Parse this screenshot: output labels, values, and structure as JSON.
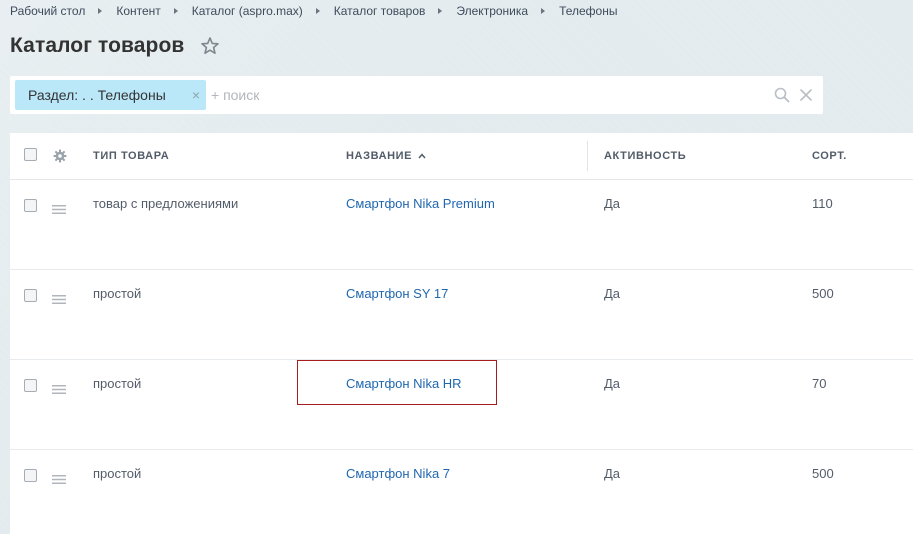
{
  "breadcrumbs": [
    "Рабочий стол",
    "Контент",
    "Каталог (aspro.max)",
    "Каталог товаров",
    "Электроника",
    "Телефоны"
  ],
  "page": {
    "title": "Каталог товаров"
  },
  "filter": {
    "chip_label": "Раздел: . . Телефоны",
    "chip_close": "×",
    "search_placeholder": "+ поиск"
  },
  "table": {
    "columns": {
      "type": "Тип товара",
      "name": "Название",
      "active": "Активность",
      "sort": "Сорт."
    },
    "rows": [
      {
        "type": "товар с предложениями",
        "name": "Смартфон Nika Premium",
        "active": "Да",
        "sort": "110"
      },
      {
        "type": "простой",
        "name": "Смартфон SY 17",
        "active": "Да",
        "sort": "500"
      },
      {
        "type": "простой",
        "name": "Смартфон Nika HR",
        "active": "Да",
        "sort": "70"
      },
      {
        "type": "простой",
        "name": "Смартфон Nika 7",
        "active": "Да",
        "sort": "500"
      }
    ]
  },
  "colors": {
    "link": "#2067b0",
    "chip_bg": "#bbe8f9",
    "highlight_border": "#a51d1d",
    "page_bg": "#e3ebee"
  },
  "icons": [
    "star-icon",
    "search-icon",
    "close-icon",
    "gear-icon",
    "drag-handle-icon",
    "sort-asc-icon"
  ]
}
